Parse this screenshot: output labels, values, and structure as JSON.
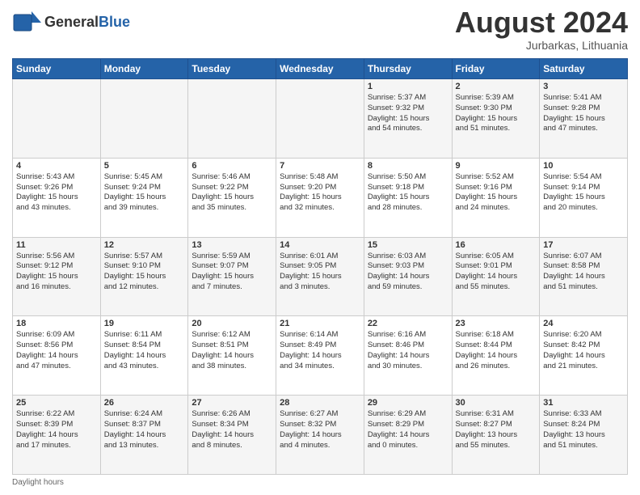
{
  "header": {
    "logo_line1": "General",
    "logo_line2": "Blue",
    "month_title": "August 2024",
    "location": "Jurbarkas, Lithuania"
  },
  "days_of_week": [
    "Sunday",
    "Monday",
    "Tuesday",
    "Wednesday",
    "Thursday",
    "Friday",
    "Saturday"
  ],
  "weeks": [
    [
      {
        "day": "",
        "info": ""
      },
      {
        "day": "",
        "info": ""
      },
      {
        "day": "",
        "info": ""
      },
      {
        "day": "",
        "info": ""
      },
      {
        "day": "1",
        "info": "Sunrise: 5:37 AM\nSunset: 9:32 PM\nDaylight: 15 hours\nand 54 minutes."
      },
      {
        "day": "2",
        "info": "Sunrise: 5:39 AM\nSunset: 9:30 PM\nDaylight: 15 hours\nand 51 minutes."
      },
      {
        "day": "3",
        "info": "Sunrise: 5:41 AM\nSunset: 9:28 PM\nDaylight: 15 hours\nand 47 minutes."
      }
    ],
    [
      {
        "day": "4",
        "info": "Sunrise: 5:43 AM\nSunset: 9:26 PM\nDaylight: 15 hours\nand 43 minutes."
      },
      {
        "day": "5",
        "info": "Sunrise: 5:45 AM\nSunset: 9:24 PM\nDaylight: 15 hours\nand 39 minutes."
      },
      {
        "day": "6",
        "info": "Sunrise: 5:46 AM\nSunset: 9:22 PM\nDaylight: 15 hours\nand 35 minutes."
      },
      {
        "day": "7",
        "info": "Sunrise: 5:48 AM\nSunset: 9:20 PM\nDaylight: 15 hours\nand 32 minutes."
      },
      {
        "day": "8",
        "info": "Sunrise: 5:50 AM\nSunset: 9:18 PM\nDaylight: 15 hours\nand 28 minutes."
      },
      {
        "day": "9",
        "info": "Sunrise: 5:52 AM\nSunset: 9:16 PM\nDaylight: 15 hours\nand 24 minutes."
      },
      {
        "day": "10",
        "info": "Sunrise: 5:54 AM\nSunset: 9:14 PM\nDaylight: 15 hours\nand 20 minutes."
      }
    ],
    [
      {
        "day": "11",
        "info": "Sunrise: 5:56 AM\nSunset: 9:12 PM\nDaylight: 15 hours\nand 16 minutes."
      },
      {
        "day": "12",
        "info": "Sunrise: 5:57 AM\nSunset: 9:10 PM\nDaylight: 15 hours\nand 12 minutes."
      },
      {
        "day": "13",
        "info": "Sunrise: 5:59 AM\nSunset: 9:07 PM\nDaylight: 15 hours\nand 7 minutes."
      },
      {
        "day": "14",
        "info": "Sunrise: 6:01 AM\nSunset: 9:05 PM\nDaylight: 15 hours\nand 3 minutes."
      },
      {
        "day": "15",
        "info": "Sunrise: 6:03 AM\nSunset: 9:03 PM\nDaylight: 14 hours\nand 59 minutes."
      },
      {
        "day": "16",
        "info": "Sunrise: 6:05 AM\nSunset: 9:01 PM\nDaylight: 14 hours\nand 55 minutes."
      },
      {
        "day": "17",
        "info": "Sunrise: 6:07 AM\nSunset: 8:58 PM\nDaylight: 14 hours\nand 51 minutes."
      }
    ],
    [
      {
        "day": "18",
        "info": "Sunrise: 6:09 AM\nSunset: 8:56 PM\nDaylight: 14 hours\nand 47 minutes."
      },
      {
        "day": "19",
        "info": "Sunrise: 6:11 AM\nSunset: 8:54 PM\nDaylight: 14 hours\nand 43 minutes."
      },
      {
        "day": "20",
        "info": "Sunrise: 6:12 AM\nSunset: 8:51 PM\nDaylight: 14 hours\nand 38 minutes."
      },
      {
        "day": "21",
        "info": "Sunrise: 6:14 AM\nSunset: 8:49 PM\nDaylight: 14 hours\nand 34 minutes."
      },
      {
        "day": "22",
        "info": "Sunrise: 6:16 AM\nSunset: 8:46 PM\nDaylight: 14 hours\nand 30 minutes."
      },
      {
        "day": "23",
        "info": "Sunrise: 6:18 AM\nSunset: 8:44 PM\nDaylight: 14 hours\nand 26 minutes."
      },
      {
        "day": "24",
        "info": "Sunrise: 6:20 AM\nSunset: 8:42 PM\nDaylight: 14 hours\nand 21 minutes."
      }
    ],
    [
      {
        "day": "25",
        "info": "Sunrise: 6:22 AM\nSunset: 8:39 PM\nDaylight: 14 hours\nand 17 minutes."
      },
      {
        "day": "26",
        "info": "Sunrise: 6:24 AM\nSunset: 8:37 PM\nDaylight: 14 hours\nand 13 minutes."
      },
      {
        "day": "27",
        "info": "Sunrise: 6:26 AM\nSunset: 8:34 PM\nDaylight: 14 hours\nand 8 minutes."
      },
      {
        "day": "28",
        "info": "Sunrise: 6:27 AM\nSunset: 8:32 PM\nDaylight: 14 hours\nand 4 minutes."
      },
      {
        "day": "29",
        "info": "Sunrise: 6:29 AM\nSunset: 8:29 PM\nDaylight: 14 hours\nand 0 minutes."
      },
      {
        "day": "30",
        "info": "Sunrise: 6:31 AM\nSunset: 8:27 PM\nDaylight: 13 hours\nand 55 minutes."
      },
      {
        "day": "31",
        "info": "Sunrise: 6:33 AM\nSunset: 8:24 PM\nDaylight: 13 hours\nand 51 minutes."
      }
    ]
  ],
  "footer": {
    "daylight_label": "Daylight hours"
  }
}
